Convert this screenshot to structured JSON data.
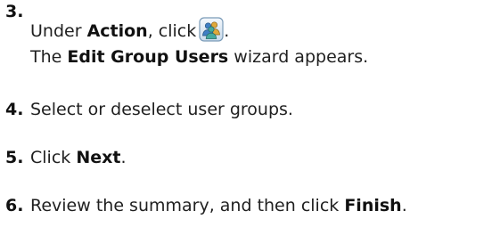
{
  "steps": [
    {
      "number": "3.",
      "line1_prefix": "Under ",
      "line1_bold": "Action",
      "line1_mid": ", click",
      "line1_suffix": ".",
      "line2_prefix": "The ",
      "line2_bold": "Edit Group Users",
      "line2_suffix": " wizard appears.",
      "icon": "group-users-icon"
    },
    {
      "number": "4.",
      "text": "Select or deselect user groups."
    },
    {
      "number": "5.",
      "prefix": "Click ",
      "bold": "Next",
      "suffix": "."
    },
    {
      "number": "6.",
      "prefix": "Review the summary, and then click ",
      "bold": "Finish",
      "suffix": "."
    }
  ],
  "colors": {
    "text": "#1f1f1f",
    "icon_border": "#7a9bb8",
    "icon_fill": "#dbe8f4"
  }
}
